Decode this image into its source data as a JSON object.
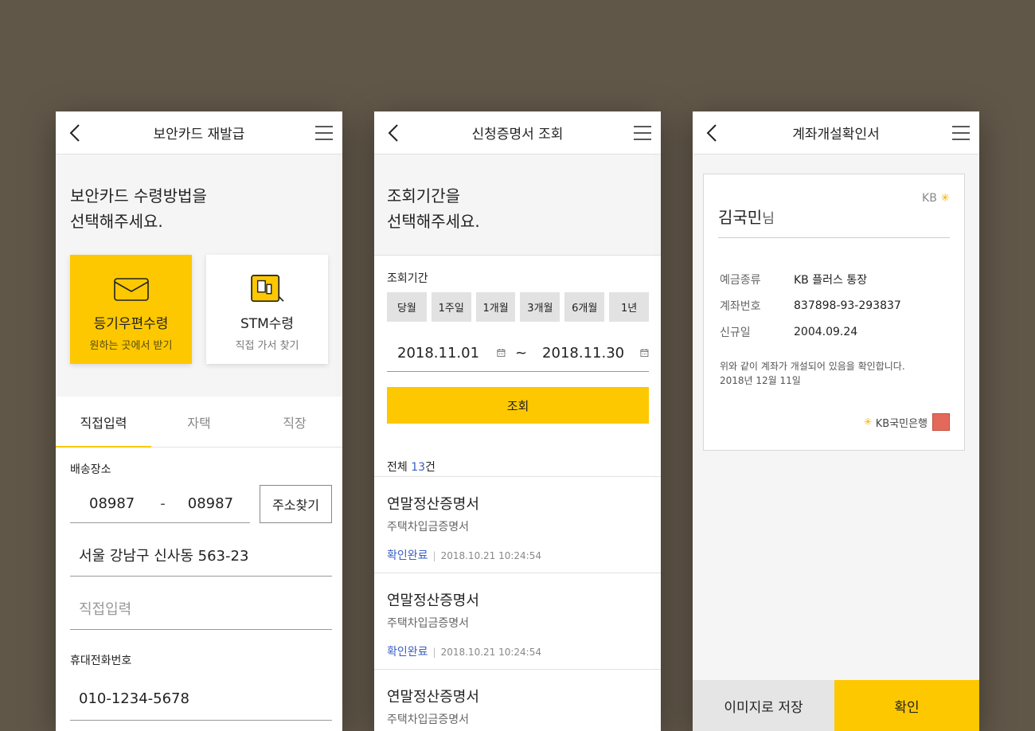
{
  "colors": {
    "background": "#615749",
    "accent": "#fdc800",
    "link": "#3a5fc4"
  },
  "screen1": {
    "title": "보안카드 재발급",
    "intro_line1": "보안카드 수령방법을",
    "intro_line2": "선택해주세요.",
    "options": [
      {
        "title": "등기우편수령",
        "subtitle": "원하는 곳에서 받기",
        "icon": "envelope-icon",
        "selected": true
      },
      {
        "title": "STM수령",
        "subtitle": "직접 가서 찾기",
        "icon": "stm-machine-icon",
        "selected": false
      }
    ],
    "tabs": [
      "직접입력",
      "자택",
      "직장"
    ],
    "active_tab": "직접입력",
    "delivery_label": "배송장소",
    "zip1": "08987",
    "zip_dash": "-",
    "zip2": "08987",
    "address_button": "주소찾기",
    "address": "서울 강남구 신사동 563-23",
    "detail_placeholder": "직접입력",
    "phone_label": "휴대전화번호",
    "phone": "010-1234-5678"
  },
  "screen2": {
    "title": "신청증명서 조회",
    "intro_line1": "조회기간을",
    "intro_line2": "선택해주세요.",
    "period_label": "조회기간",
    "periods": [
      "당월",
      "1주일",
      "1개월",
      "3개월",
      "6개월",
      "1년"
    ],
    "date_from": "2018.11.01",
    "date_sep": "~",
    "date_to": "2018.11.30",
    "search_button": "조회",
    "count_prefix": "전체 ",
    "count_value": "13",
    "count_suffix": "건",
    "items": [
      {
        "title": "연말정산증명서",
        "subtitle": "주택차입금증명서",
        "status": "확인완료",
        "timestamp": "2018.10.21 10:24:54"
      },
      {
        "title": "연말정산증명서",
        "subtitle": "주택차입금증명서",
        "status": "확인완료",
        "timestamp": "2018.10.21 10:24:54"
      },
      {
        "title": "연말정산증명서",
        "subtitle": "주택차입금증명서",
        "status": "",
        "timestamp": ""
      }
    ]
  },
  "screen3": {
    "title": "계좌개설확인서",
    "logo_text": "KB",
    "customer_name": "김국민",
    "name_suffix": "님",
    "rows": [
      {
        "key": "예금종류",
        "value": "KB 플러스 통장"
      },
      {
        "key": "계좌번호",
        "value": "837898-93-293837"
      },
      {
        "key": "신규일",
        "value": "2004.09.24"
      }
    ],
    "note_line1": "위와 같이 계좌가 개설되어 있음을 확인합니다.",
    "note_line2": "2018년 12월 11일",
    "bank_name": "KB국민은행",
    "save_button": "이미지로 저장",
    "confirm_button": "확인"
  }
}
